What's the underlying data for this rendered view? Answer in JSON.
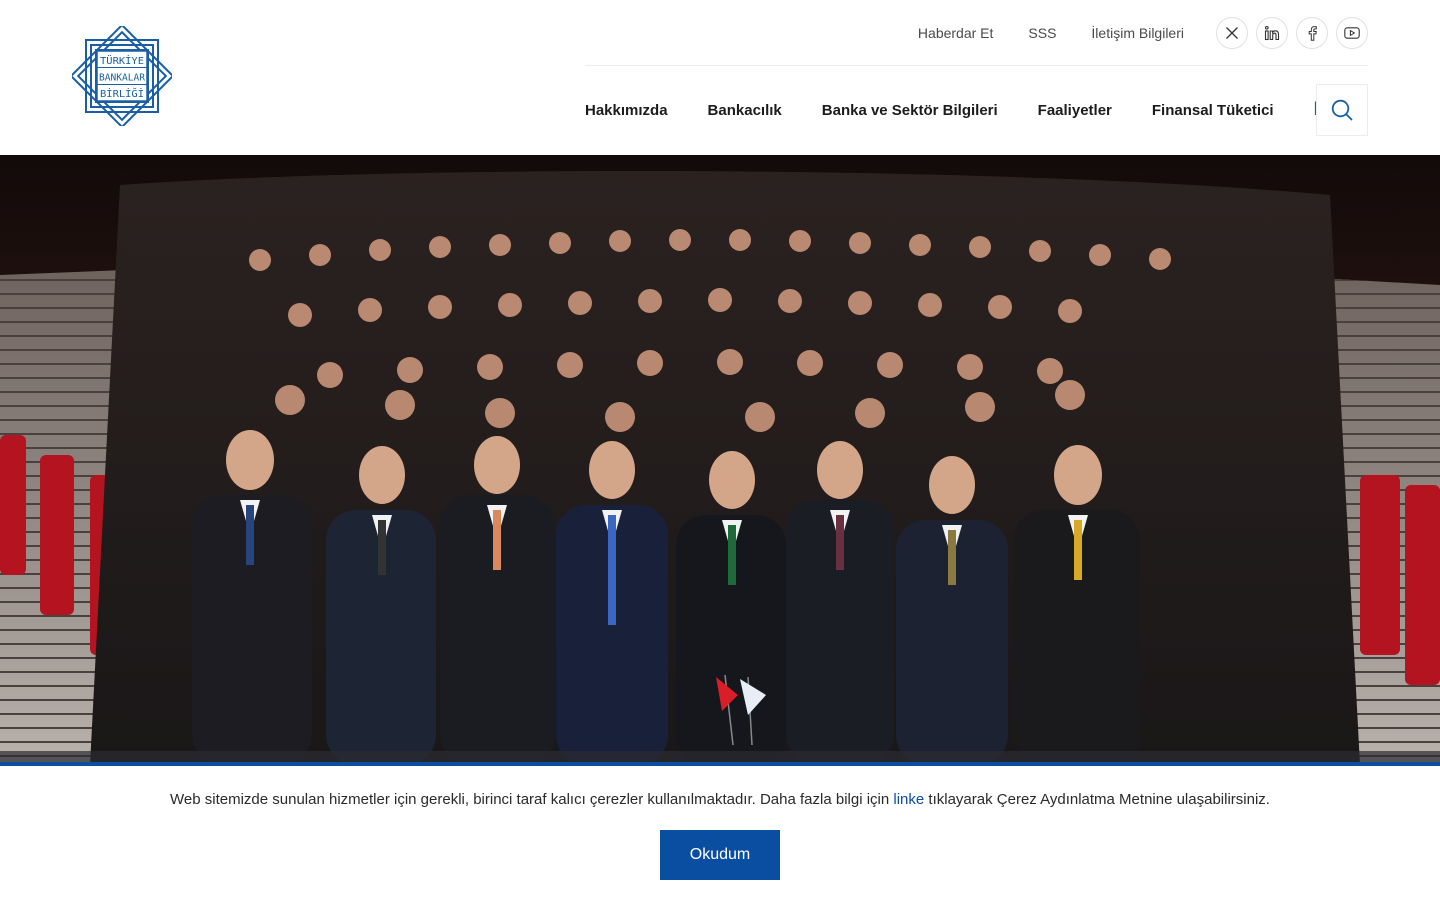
{
  "brand": {
    "logo_lines": [
      "TÜRKİYE",
      "BANKALAR",
      "BİRLİĞİ"
    ],
    "color": "#1a5fa3"
  },
  "top_links": [
    "Haberdar Et",
    "SSS",
    "İletişim Bilgileri"
  ],
  "social": [
    "x-icon",
    "linkedin-icon",
    "facebook-icon",
    "youtube-icon"
  ],
  "nav": {
    "items": [
      "Hakkımızda",
      "Bankacılık",
      "Banka ve Sektör Bilgileri",
      "Faaliyetler",
      "Finansal Tüketici"
    ],
    "lang": "EN",
    "search_icon": "search-icon"
  },
  "hero": {
    "accent": "#0b4ea2"
  },
  "cookie": {
    "text_before": "Web sitemizde sunulan hizmetler için gerekli, birinci taraf kalıcı çerezler kullanılmaktadır. Daha fazla bilgi için ",
    "link_text": "linke",
    "text_after": " tıklayarak Çerez Aydınlatma Metnine ulaşabilirsiniz.",
    "button_label": "Okudum",
    "button_color": "#0a4ea2"
  }
}
